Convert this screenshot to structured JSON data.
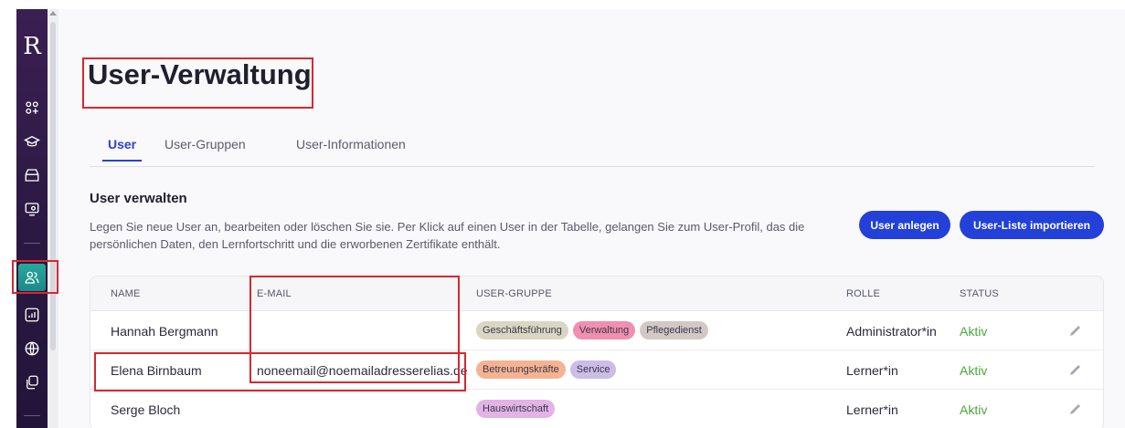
{
  "sidebar": {
    "logo": "R",
    "icons": [
      "apps-add-icon",
      "graduation-cap-icon",
      "archive-box-icon",
      "monitor-user-icon",
      "users-icon",
      "report-chart-icon",
      "globe-icon",
      "copy-icon"
    ]
  },
  "page": {
    "title": "User-Verwaltung"
  },
  "tabs": [
    {
      "label": "User"
    },
    {
      "label": "User-Gruppen"
    },
    {
      "label": "User-Informationen"
    }
  ],
  "section": {
    "title": "User verwalten",
    "description": "Legen Sie neue User an, bearbeiten oder löschen Sie sie. Per Klick auf einen User in der Tabelle, gelangen Sie zum User-Profil, das die persönlichen Daten, den Lernfortschritt und die erworbenen Zertifikate enthält."
  },
  "buttons": {
    "create_user": "User anlegen",
    "import_list": "User-Liste importieren"
  },
  "table": {
    "headers": {
      "name": "NAME",
      "email": "E-MAIL",
      "group": "USER-GRUPPE",
      "role": "ROLLE",
      "status": "STATUS"
    },
    "rows": [
      {
        "name": "Hannah Bergmann",
        "email": "",
        "role": "Administrator*in",
        "status": "Aktiv",
        "groups": [
          {
            "label": "Geschäftsführung",
            "color": "#d9d6c3"
          },
          {
            "label": "Verwaltung",
            "color": "#f08fb0"
          },
          {
            "label": "Pflegedienst",
            "color": "#d2c8c6"
          }
        ]
      },
      {
        "name": "Elena Birnbaum",
        "email": "noneemail@noemailadresserelias.de",
        "role": "Lerner*in",
        "status": "Aktiv",
        "groups": [
          {
            "label": "Betreuungskräfte",
            "color": "#f6b394"
          },
          {
            "label": "Service",
            "color": "#cbbde6"
          }
        ]
      },
      {
        "name": "Serge Bloch",
        "email": "",
        "role": "Lerner*in",
        "status": "Aktiv",
        "groups": [
          {
            "label": "Hauswirtschaft",
            "color": "#e2b3e6"
          }
        ]
      }
    ]
  },
  "colors": {
    "accent": "#2340d8",
    "active_sidebar": "#1f9a93",
    "status_active": "#47a83a",
    "highlight": "#d8272f"
  }
}
